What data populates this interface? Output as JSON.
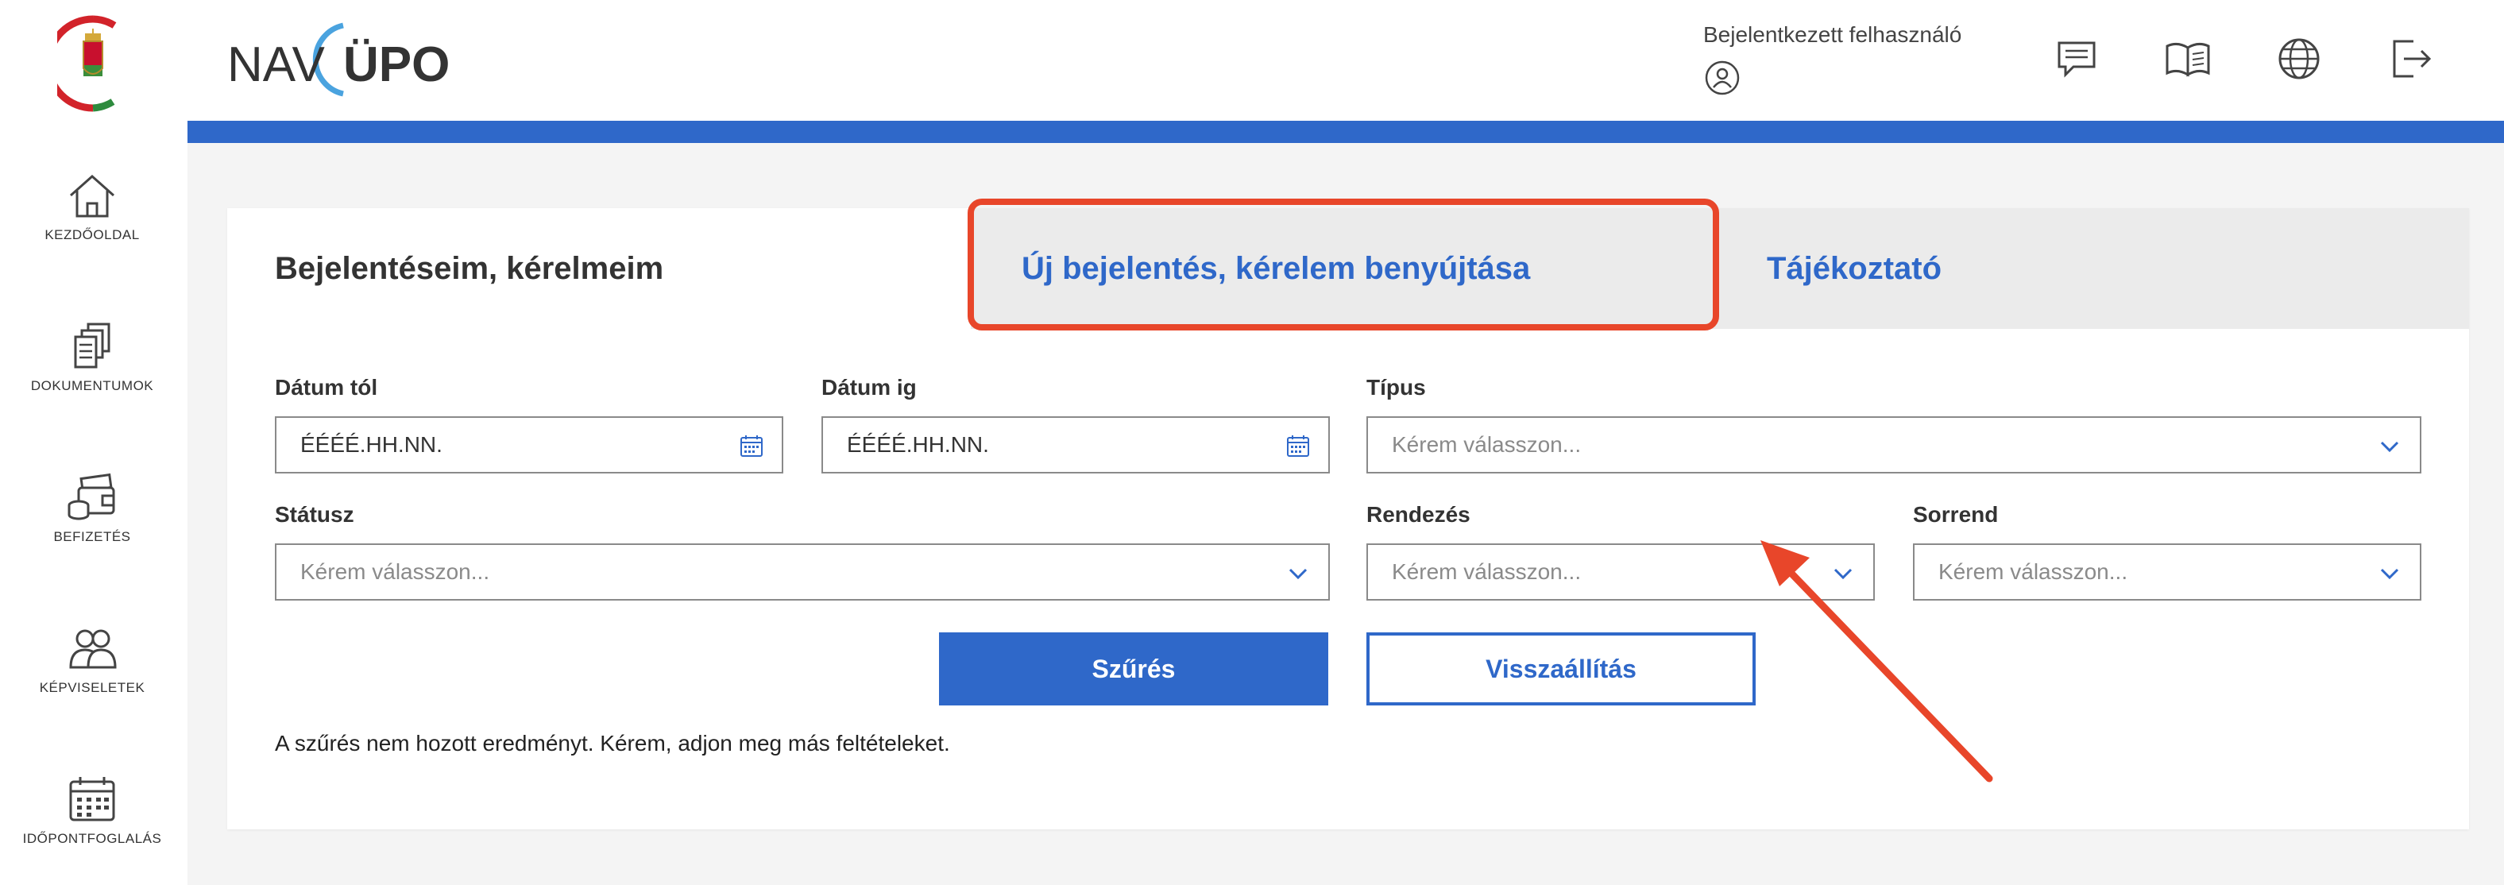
{
  "sidebar": {
    "items": [
      {
        "label": "KEZDŐOLDAL",
        "icon": "home-icon"
      },
      {
        "label": "DOKUMENTUMOK",
        "icon": "documents-icon"
      },
      {
        "label": "BEFIZETÉS",
        "icon": "wallet-coins-icon"
      },
      {
        "label": "KÉPVISELETEK",
        "icon": "people-icon"
      },
      {
        "label": "IDŐPONTFOGLALÁS",
        "icon": "calendar-icon"
      }
    ]
  },
  "header": {
    "logo_left": "NAV",
    "logo_right": "ÜPO",
    "user_label": "Bejelentkezett felhasználó",
    "icons": [
      "message-icon",
      "manual-book-icon",
      "globe-icon",
      "logout-icon"
    ]
  },
  "tabs": [
    {
      "label": "Bejelentéseim, kérelmeim",
      "active": true
    },
    {
      "label": "Új bejelentés, kérelem benyújtása",
      "active": false
    },
    {
      "label": "Tájékoztató",
      "active": false
    }
  ],
  "filters": {
    "date_from": {
      "label": "Dátum tól",
      "value": "ÉÉÉÉ.HH.NN."
    },
    "date_to": {
      "label": "Dátum ig",
      "value": "ÉÉÉÉ.HH.NN."
    },
    "type": {
      "label": "Típus",
      "placeholder": "Kérem válasszon..."
    },
    "status": {
      "label": "Státusz",
      "placeholder": "Kérem válasszon..."
    },
    "sort_by": {
      "label": "Rendezés",
      "placeholder": "Kérem válasszon..."
    },
    "order": {
      "label": "Sorrend",
      "placeholder": "Kérem válasszon..."
    }
  },
  "buttons": {
    "filter": "Szűrés",
    "reset": "Visszaállítás"
  },
  "message": "A szűrés nem hozott eredményt. Kérem, adjon meg más feltételeket.",
  "colors": {
    "brand_blue": "#2f68c9",
    "highlight_red": "#e8462a"
  }
}
